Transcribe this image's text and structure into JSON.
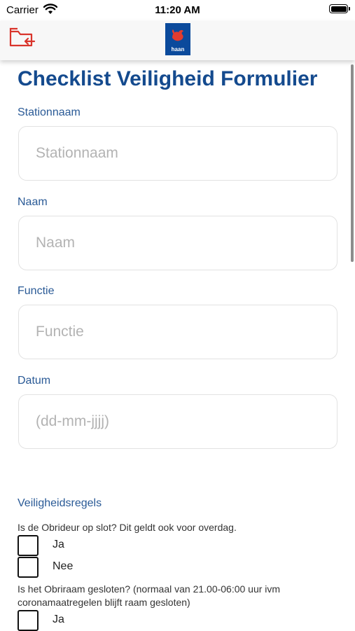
{
  "status_bar": {
    "carrier": "Carrier",
    "time": "11:20 AM"
  },
  "nav": {
    "logo_text": "haan",
    "logo_color": "#0b4a9c",
    "back_icon": "folder-return-icon"
  },
  "page": {
    "title": "Checklist Veiligheid Formulier"
  },
  "fields": {
    "stationnaam": {
      "label": "Stationnaam",
      "placeholder": "Stationnaam",
      "value": ""
    },
    "naam": {
      "label": "Naam",
      "placeholder": "Naam",
      "value": ""
    },
    "functie": {
      "label": "Functie",
      "placeholder": "Functie",
      "value": ""
    },
    "datum": {
      "label": "Datum",
      "placeholder": "(dd-mm-jjjj)",
      "value": ""
    }
  },
  "rules": {
    "heading": "Veiligheidsregels",
    "questions": [
      {
        "text": "Is de Obrideur op slot? Dit geldt ook voor overdag.",
        "options": [
          "Ja",
          "Nee"
        ]
      },
      {
        "text": "Is het Obriraam gesloten? (normaal van 21.00-06:00 uur ivm coronamaatregelen blijft raam gesloten)",
        "options": [
          "Ja"
        ]
      }
    ]
  },
  "colors": {
    "accent": "#144a8e",
    "label": "#2a5a96",
    "icon_red": "#d9342b"
  }
}
